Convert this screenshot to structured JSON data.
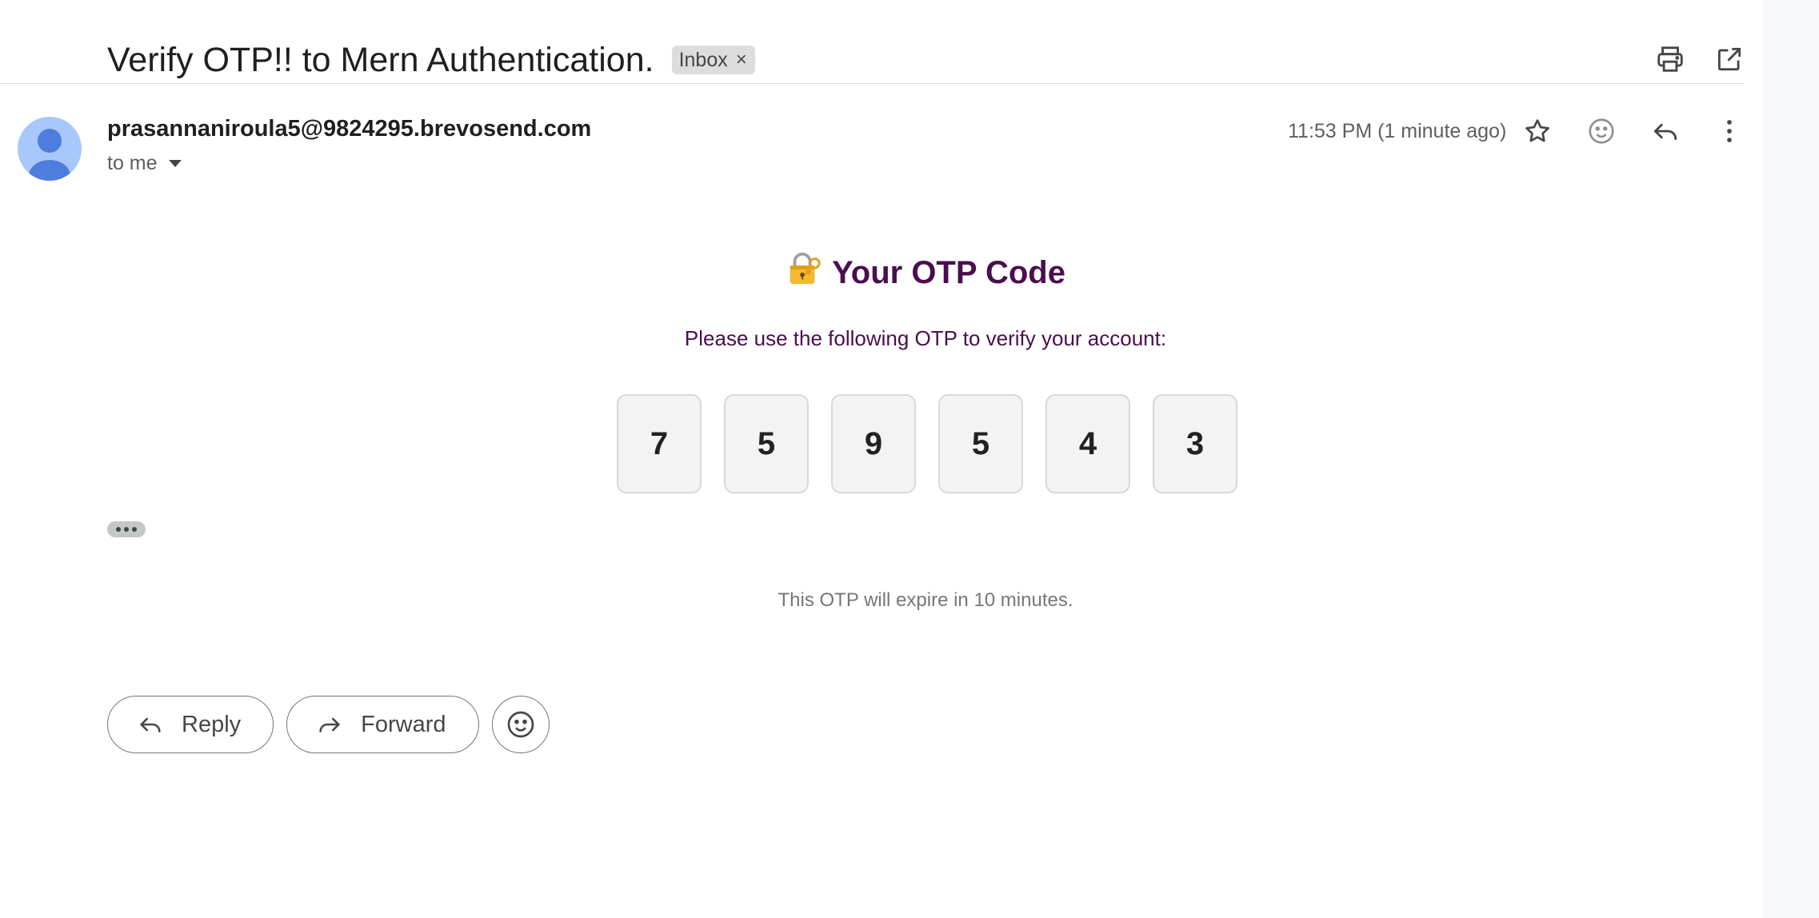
{
  "email": {
    "subject": "Verify OTP!! to Mern Authentication.",
    "label_chip": "Inbox",
    "label_chip_close": "×",
    "sender": "prasannaniroula5@9824295.brevosend.com",
    "recipient_line": "to me",
    "timestamp": "11:53 PM (1 minute ago)"
  },
  "icons": {
    "header": [
      "print-icon",
      "open-in-new-window-icon"
    ],
    "message_actions": [
      "star-icon",
      "emoji-reaction-icon",
      "reply-icon",
      "more-vertical-icon"
    ]
  },
  "body": {
    "heading_emoji": "lock-with-key-icon",
    "heading": "Your OTP Code",
    "instruction": "Please use the following OTP to verify your account:",
    "otp_digits": [
      "7",
      "5",
      "9",
      "5",
      "4",
      "3"
    ],
    "expire_note": "This OTP will expire in 10 minutes."
  },
  "footer_actions": {
    "reply_label": "Reply",
    "forward_label": "Forward"
  },
  "colors": {
    "heading_text": "#4a0e4e",
    "avatar_bg": "#a8c7fa",
    "avatar_fg": "#4e7de0",
    "otp_box_bg": "#f3f3f3"
  }
}
